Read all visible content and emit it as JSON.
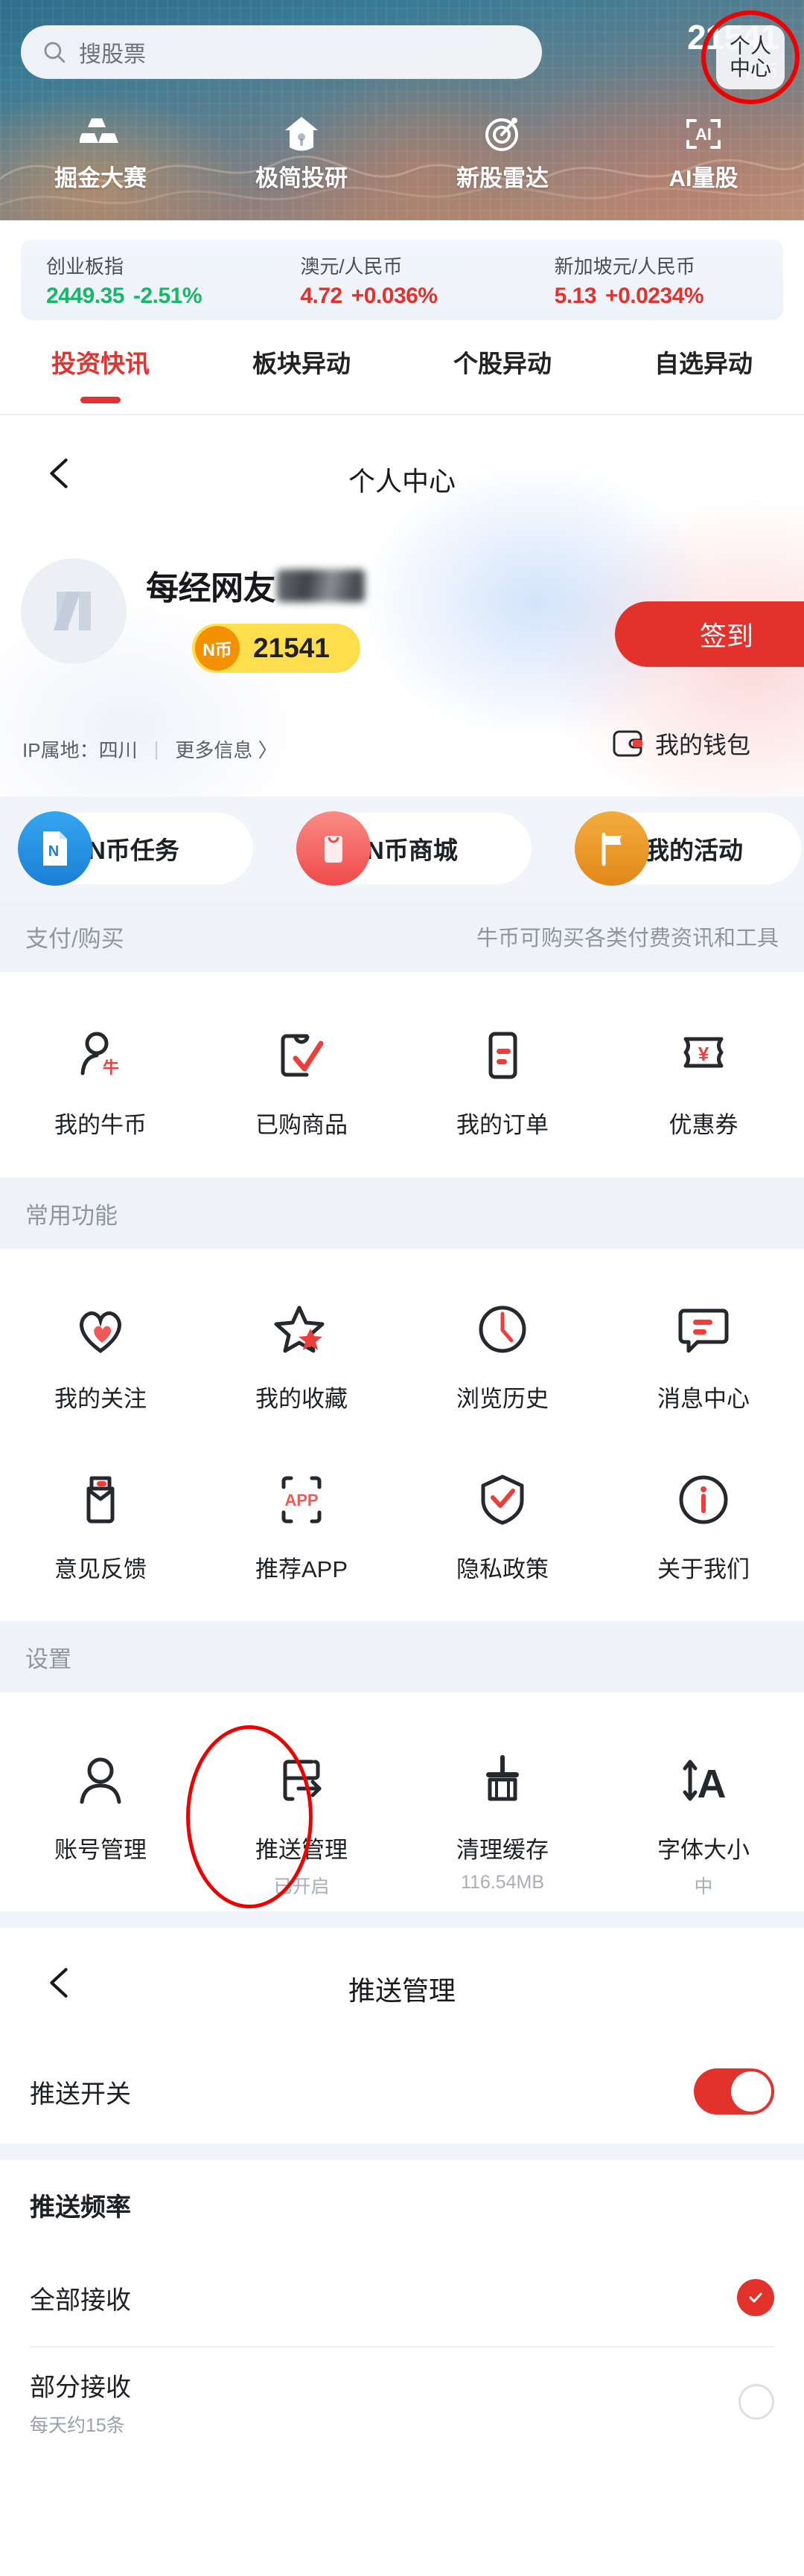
{
  "banner": {
    "search": {
      "placeholder": "搜股票",
      "icon": "search-icon"
    },
    "coin_amount": "21541",
    "coin_unit": "N币",
    "personal_center_line1": "个人",
    "personal_center_line2": "中心",
    "quicknav": [
      {
        "label": "掘金大赛",
        "icon": "gold-bars-icon"
      },
      {
        "label": "极简投研",
        "icon": "diamond-icon"
      },
      {
        "label": "新股雷达",
        "icon": "radar-target-icon"
      },
      {
        "label": "AI量股",
        "icon": "ai-scan-icon"
      }
    ]
  },
  "indices": [
    {
      "name": "创业板指",
      "value": "2449.35",
      "change": "-2.51%",
      "color": "#14b866"
    },
    {
      "name": "澳元/人民币",
      "value": "4.72",
      "change": "+0.036%",
      "color": "#e3312c"
    },
    {
      "name": "新加坡元/人民币",
      "value": "5.13",
      "change": "+0.0234%",
      "color": "#e3312c"
    }
  ],
  "tabs": [
    {
      "label": "投资快讯",
      "active": true
    },
    {
      "label": "板块异动",
      "active": false
    },
    {
      "label": "个股异动",
      "active": false
    },
    {
      "label": "自选异动",
      "active": false
    }
  ],
  "profile": {
    "nav_title": "个人中心",
    "back_icon": "chevron-left-icon",
    "avatar_icon": "avatar-placeholder-icon",
    "username": "每经网友",
    "coin_badge_text": "N币",
    "coin_value": "21541",
    "ip_location": "IP属地：四川",
    "ip_separator": "|",
    "more_info": "更多信息 〉",
    "signin_label": "签到",
    "wallet_label": "我的钱包",
    "wallet_icon": "wallet-icon"
  },
  "chips": [
    {
      "label": "N币任务",
      "icon": "n-coin-task-icon",
      "color": "#2196f3"
    },
    {
      "label": "N币商城",
      "icon": "shopping-bag-icon",
      "color": "#ef4a4a"
    },
    {
      "label": "我的活动",
      "icon": "flag-icon",
      "color": "#ef9a1e"
    }
  ],
  "sections": [
    {
      "title": "支付/购买",
      "hint": "牛币可购买各类付费资讯和工具",
      "rows": [
        [
          {
            "label": "我的牛币",
            "icon": "person-coin-icon",
            "sub": ""
          },
          {
            "label": "已购商品",
            "icon": "purchased-check-icon",
            "sub": ""
          },
          {
            "label": "我的订单",
            "icon": "order-list-icon",
            "sub": ""
          },
          {
            "label": "优惠券",
            "icon": "coupon-yen-icon",
            "sub": ""
          }
        ]
      ]
    },
    {
      "title": "常用功能",
      "hint": "",
      "rows": [
        [
          {
            "label": "我的关注",
            "icon": "heart-icon",
            "sub": ""
          },
          {
            "label": "我的收藏",
            "icon": "star-icon",
            "sub": ""
          },
          {
            "label": "浏览历史",
            "icon": "clock-icon",
            "sub": ""
          },
          {
            "label": "消息中心",
            "icon": "message-icon",
            "sub": ""
          }
        ],
        [
          {
            "label": "意见反馈",
            "icon": "feedback-icon",
            "sub": ""
          },
          {
            "label": "推荐APP",
            "icon": "recommend-app-icon",
            "sub": ""
          },
          {
            "label": "隐私政策",
            "icon": "shield-check-icon",
            "sub": ""
          },
          {
            "label": "关于我们",
            "icon": "info-icon",
            "sub": ""
          }
        ]
      ]
    },
    {
      "title": "设置",
      "hint": "",
      "rows": [
        [
          {
            "label": "账号管理",
            "icon": "account-person-icon",
            "sub": ""
          },
          {
            "label": "推送管理",
            "icon": "push-arrow-icon",
            "sub": "已开启"
          },
          {
            "label": "清理缓存",
            "icon": "broom-icon",
            "sub": "116.54MB"
          },
          {
            "label": "字体大小",
            "icon": "font-size-icon",
            "sub": "中"
          }
        ]
      ]
    }
  ],
  "push_screen": {
    "nav_title": "推送管理",
    "back_icon": "chevron-left-icon",
    "switch_label": "推送开关",
    "switch_on": true,
    "frequency_title": "推送频率",
    "options": [
      {
        "label": "全部接收",
        "sub": "",
        "selected": true
      },
      {
        "label": "部分接收",
        "sub": "每天约15条",
        "selected": false
      }
    ]
  },
  "colors": {
    "brand_red": "#e3312c",
    "highlight_ring": "#ee0000",
    "coin_yellow": "#ffde4d",
    "up_red": "#e3312c",
    "down_green": "#14b866",
    "section_bg": "#eff3f8"
  }
}
